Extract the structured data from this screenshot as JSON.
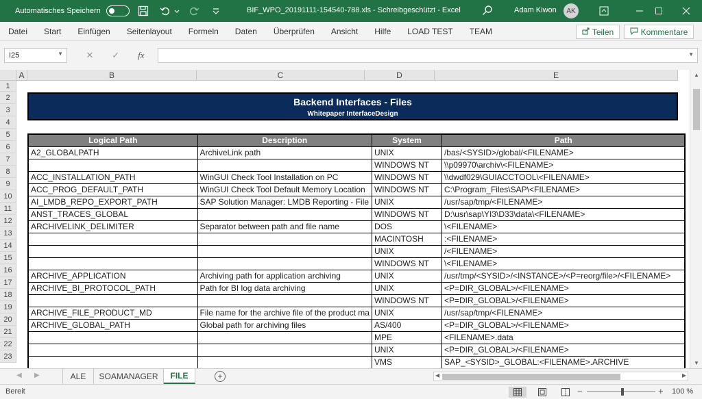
{
  "titlebar": {
    "autosave_label": "Automatisches Speichern",
    "document_title": "BIF_WPO_20191111-154540-788.xls  -  Schreibgeschützt  -  Excel",
    "user_name": "Adam Kiwon",
    "user_initials": "AK"
  },
  "menu": {
    "items": [
      "Datei",
      "Start",
      "Einfügen",
      "Seitenlayout",
      "Formeln",
      "Daten",
      "Überprüfen",
      "Ansicht",
      "Hilfe",
      "LOAD TEST",
      "TEAM"
    ],
    "share_label": "Teilen",
    "comments_label": "Kommentare"
  },
  "formula_bar": {
    "name_box": "I25",
    "fx_label": "fx",
    "formula": ""
  },
  "columns": [
    {
      "letter": "A"
    },
    {
      "letter": "B"
    },
    {
      "letter": "C"
    },
    {
      "letter": "D"
    },
    {
      "letter": "E"
    }
  ],
  "rows": [
    "1",
    "2",
    "3",
    "4",
    "5",
    "6",
    "7",
    "8",
    "9",
    "10",
    "11",
    "12",
    "13",
    "14",
    "15",
    "16",
    "17",
    "18",
    "19",
    "20",
    "21",
    "22",
    "23"
  ],
  "banner": {
    "title": "Backend Interfaces - Files",
    "subtitle": "Whitepaper InterfaceDesign"
  },
  "table": {
    "headers": [
      "Logical Path",
      "Description",
      "System",
      "Path"
    ],
    "rows": [
      [
        "A2_GLOBALPATH",
        "ArchiveLink path",
        "UNIX",
        "/bas/<SYSID>/global/<FILENAME>"
      ],
      [
        "",
        "",
        "WINDOWS NT",
        "\\\\p09970\\archiv\\<FILENAME>"
      ],
      [
        "ACC_INSTALLATION_PATH",
        "WinGUI Check Tool Installation on PC",
        "WINDOWS NT",
        "\\\\dwdf029\\GUIACCTOOL\\<FILENAME>"
      ],
      [
        "ACC_PROG_DEFAULT_PATH",
        "WinGUI Check Tool Default Memory Location",
        "WINDOWS NT",
        "C:\\Program_Files\\SAP\\<FILENAME>"
      ],
      [
        "AI_LMDB_REPO_EXPORT_PATH",
        "SAP Solution Manager: LMDB Reporting - File",
        "UNIX",
        "/usr/sap/tmp/<FILENAME>"
      ],
      [
        "ANST_TRACES_GLOBAL",
        "",
        "WINDOWS NT",
        "D:\\usr\\sap\\YI3\\D33\\data\\<FILENAME>"
      ],
      [
        "ARCHIVELINK_DELIMITER",
        "Separator between path and file name",
        "DOS",
        "\\<FILENAME>"
      ],
      [
        "",
        "",
        "MACINTOSH",
        ":<FILENAME>"
      ],
      [
        "",
        "",
        "UNIX",
        "/<FILENAME>"
      ],
      [
        "",
        "",
        "WINDOWS NT",
        "\\<FILENAME>"
      ],
      [
        "ARCHIVE_APPLICATION",
        "Archiving path for application archiving",
        "UNIX",
        "/usr/tmp/<SYSID>/<INSTANCE>/<P=reorg/file>/<FILENAME>"
      ],
      [
        "ARCHIVE_BI_PROTOCOL_PATH",
        "Path for BI log data archiving",
        "UNIX",
        "<P=DIR_GLOBAL>/<FILENAME>"
      ],
      [
        "",
        "",
        "WINDOWS NT",
        "<P=DIR_GLOBAL>/<FILENAME>"
      ],
      [
        "ARCHIVE_FILE_PRODUCT_MD",
        "File name for the archive file of the product ma",
        "UNIX",
        "/usr/sap/tmp/<FILENAME>"
      ],
      [
        "ARCHIVE_GLOBAL_PATH",
        "Global path for archiving files",
        "AS/400",
        "<P=DIR_GLOBAL>/<FILENAME>"
      ],
      [
        "",
        "",
        "MPE",
        "<FILENAME>.data"
      ],
      [
        "",
        "",
        "UNIX",
        "<P=DIR_GLOBAL>/<FILENAME>"
      ],
      [
        "",
        "",
        "VMS",
        "SAP_<SYSID>_GLOBAL:<FILENAME>.ARCHIVE"
      ]
    ]
  },
  "sheets": {
    "tabs": [
      "ALE",
      "SOAMANAGER",
      "FILE"
    ],
    "active": "FILE"
  },
  "status": {
    "ready": "Bereit",
    "zoom": "100 %"
  }
}
